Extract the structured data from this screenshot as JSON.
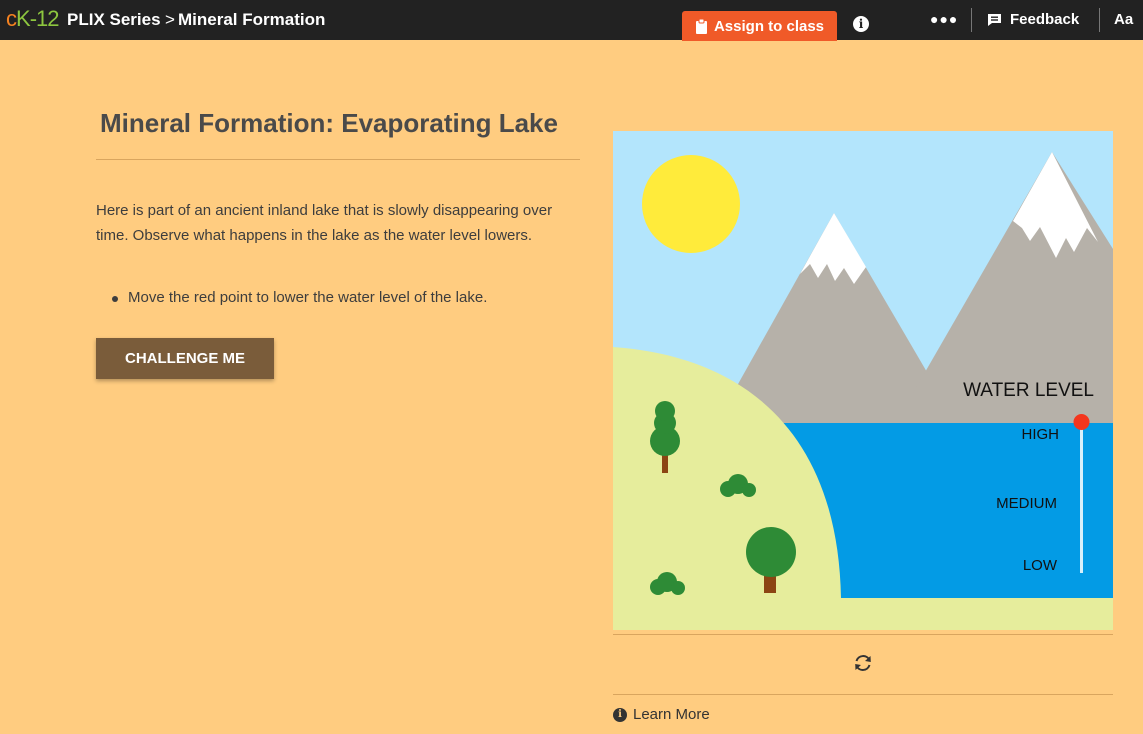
{
  "header": {
    "logo_c": "c",
    "logo_k": "K",
    "logo_n": "-12",
    "series": "PLIX Series",
    "separator": ">",
    "title": "Mineral Formation",
    "assign_label": "Assign to class",
    "info_glyph": "i",
    "more_glyph": "●●●",
    "feedback_label": "Feedback",
    "text_size_label": "Aa"
  },
  "content": {
    "title": "Mineral Formation: Evaporating Lake",
    "description": "Here is part of an ancient inland lake that is slowly disappearing over time. Observe what happens in the lake as the water level lowers.",
    "bullet": "Move the red point to lower the water level of the lake.",
    "challenge_label": "CHALLENGE ME"
  },
  "sim": {
    "water_level_label": "WATER LEVEL",
    "levels": [
      "HIGH",
      "MEDIUM",
      "LOW"
    ],
    "current_level": "HIGH",
    "colors": {
      "sky": "#b3e5fc",
      "sun": "#ffeb3b",
      "mountain": "#b6b1a9",
      "snow": "#ffffff",
      "land": "#e6ed9c",
      "water": "#039be5",
      "tree": "#2e8b36",
      "trunk": "#8b4513",
      "handle": "#f4361e"
    }
  },
  "footer": {
    "learn_more": "Learn More",
    "info_glyph": "i"
  }
}
